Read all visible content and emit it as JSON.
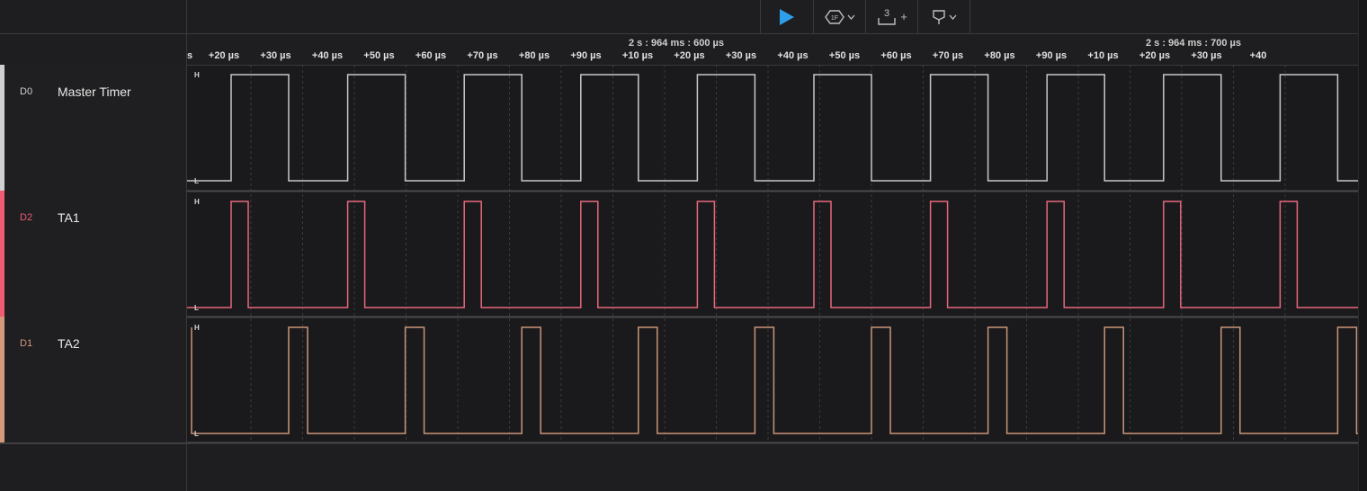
{
  "toolbar": {
    "play_label": "",
    "trigger_label": "1F",
    "measure_label": "3",
    "measure_plus": "+"
  },
  "timeline": {
    "ticks_a": [
      "s",
      "+20 µs",
      "+30 µs",
      "+40 µs",
      "+50 µs",
      "+60 µs",
      "+70 µs",
      "+80 µs",
      "+90 µs"
    ],
    "ticks_b": [
      "+10 µs",
      "+20 µs",
      "+30 µs",
      "+40 µs",
      "+50 µs",
      "+60 µs",
      "+70 µs",
      "+80 µs",
      "+90 µs"
    ],
    "ticks_c": [
      "+10 µs",
      "+20 µs",
      "+30 µs",
      "+40"
    ],
    "group_labels": [
      "2 s : 964 ms : 600 µs",
      "2 s : 964 ms : 700 µs"
    ]
  },
  "channels": [
    {
      "id": "D0",
      "name": "Master Timer",
      "color": "#d0d0d0",
      "id_color": "#d0d0d0"
    },
    {
      "id": "D2",
      "name": "TA1",
      "color": "#f05a72",
      "id_color": "#f05a72"
    },
    {
      "id": "D1",
      "name": "TA2",
      "color": "#d6987c",
      "id_color": "#d6987c"
    }
  ],
  "level_labels": {
    "high": "H",
    "low": "L"
  },
  "colors": {
    "accent_play": "#2f9ee8",
    "d0_trace": "#c8c8c8",
    "d2_trace": "#e8687c",
    "d1_trace": "#c99478"
  }
}
